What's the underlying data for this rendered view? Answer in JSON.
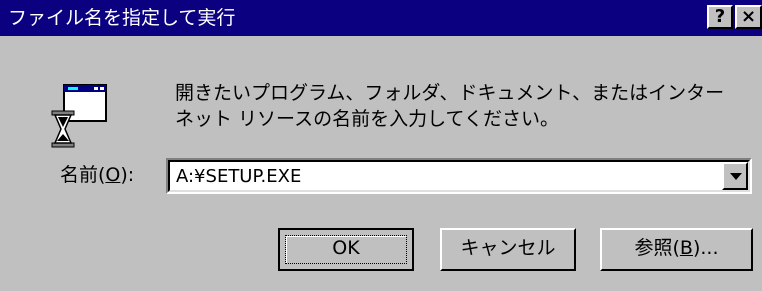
{
  "window": {
    "title": "ファイル名を指定して実行",
    "help_label": "?",
    "close_label": "×"
  },
  "dialog": {
    "icon": "run-program-icon",
    "description_line1": "開きたいプログラム、フォルダ、ドキュメント、またはインター",
    "description_line2": "ネット リソースの名前を入力してください。",
    "name_label": "名前(",
    "name_label_accel": "O",
    "name_label_tail": "):",
    "name_value": "A:¥SETUP.EXE"
  },
  "buttons": {
    "ok": "OK",
    "cancel": "キャンセル",
    "browse_prefix": "参照(",
    "browse_accel": "B",
    "browse_suffix": ")..."
  },
  "colors": {
    "titlebar": "#0a0080",
    "face": "#c0c0c0"
  }
}
